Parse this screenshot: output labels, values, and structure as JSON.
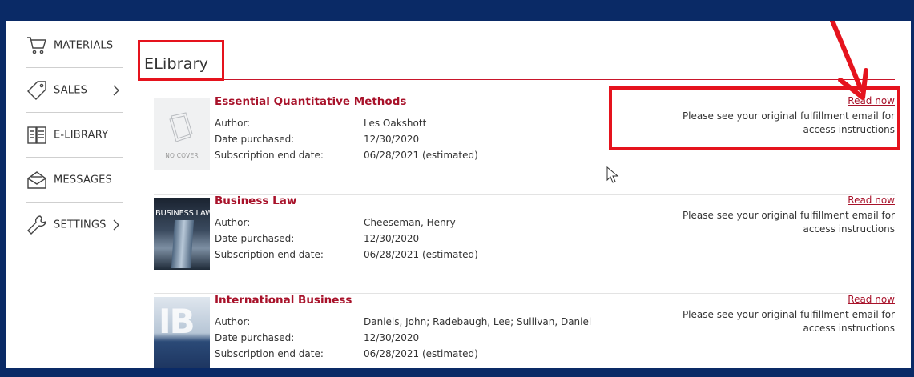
{
  "sidebar": {
    "items": [
      {
        "label": "MATERIALS",
        "icon": "cart-icon",
        "has_chevron": false
      },
      {
        "label": "SALES",
        "icon": "tag-icon",
        "has_chevron": true
      },
      {
        "label": "E-LIBRARY",
        "icon": "book-icon",
        "has_chevron": false
      },
      {
        "label": "MESSAGES",
        "icon": "envelope-icon",
        "has_chevron": false
      },
      {
        "label": "SETTINGS",
        "icon": "wrench-icon",
        "has_chevron": true
      }
    ]
  },
  "page": {
    "title": "ELibrary"
  },
  "labels": {
    "author": "Author:",
    "date_purchased": "Date purchased:",
    "subscription_end": "Subscription end date:",
    "read_now": "Read now",
    "note": "Please see your original fulfillment email for access instructions"
  },
  "books": [
    {
      "title": "Essential Quantitative Methods",
      "author": "Les Oakshott",
      "date_purchased": "12/30/2020",
      "subscription_end": "06/28/2021 (estimated)",
      "cover_text": "NO COVER"
    },
    {
      "title": "Business Law",
      "author": "Cheeseman, Henry",
      "date_purchased": "12/30/2020",
      "subscription_end": "06/28/2021 (estimated)",
      "cover_text": "BUSINESS LAW"
    },
    {
      "title": "International Business",
      "author": "Daniels, John; Radebaugh, Lee; Sullivan, Daniel",
      "date_purchased": "12/30/2020",
      "subscription_end": "06/28/2021 (estimated)",
      "cover_text": "IB"
    }
  ],
  "colors": {
    "frame": "#0a2a66",
    "accent": "#a8122a",
    "annotation": "#e5131d"
  }
}
